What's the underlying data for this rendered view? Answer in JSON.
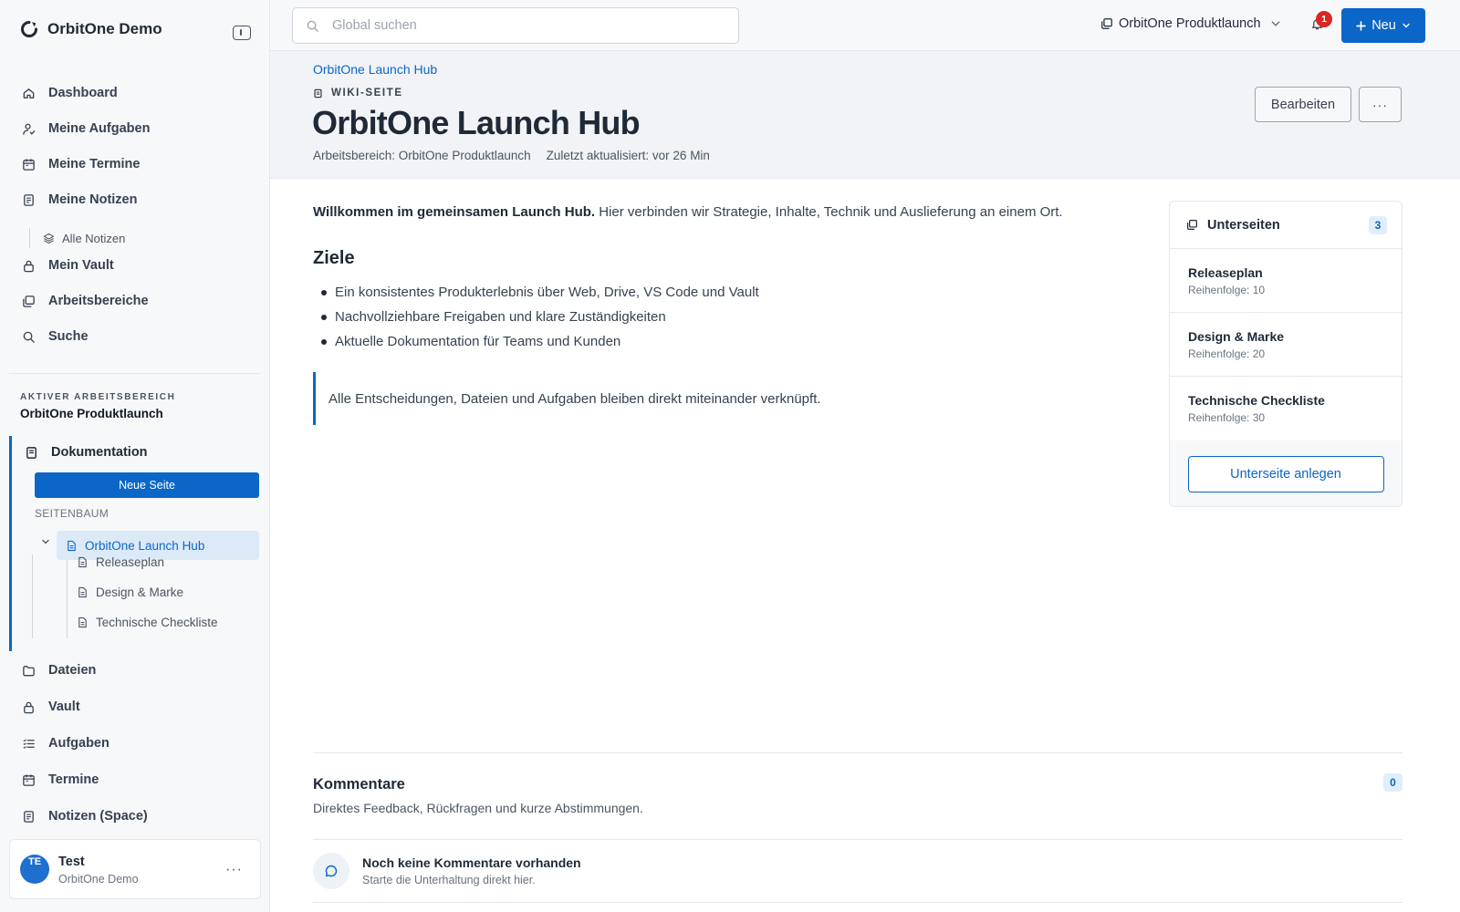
{
  "app": {
    "brand": "OrbitOne Demo"
  },
  "sidebar": {
    "nav": [
      {
        "label": "Dashboard",
        "icon": "home-icon"
      },
      {
        "label": "Meine Aufgaben",
        "icon": "user-check-icon"
      },
      {
        "label": "Meine Termine",
        "icon": "calendar-icon"
      },
      {
        "label": "Meine Notizen",
        "icon": "note-icon"
      },
      {
        "label": "Mein Vault",
        "icon": "lock-icon"
      },
      {
        "label": "Arbeitsbereiche",
        "icon": "workspaces-icon"
      },
      {
        "label": "Suche",
        "icon": "search-icon"
      }
    ],
    "sub_nav": {
      "label": "Alle Notizen",
      "icon": "layers-icon"
    },
    "active_workspace": {
      "label": "AKTIVER ARBEITSBEREICH",
      "name": "OrbitOne Produktlaunch"
    },
    "documentation": {
      "title": "Dokumentation",
      "new_page": "Neue Seite",
      "tree_label": "SEITENBAUM",
      "active_page": "OrbitOne Launch Hub",
      "children": [
        "Releaseplan",
        "Design & Marke",
        "Technische Checkliste"
      ]
    },
    "space_nav": [
      {
        "label": "Dateien",
        "icon": "folder-icon"
      },
      {
        "label": "Vault",
        "icon": "lock-icon"
      },
      {
        "label": "Aufgaben",
        "icon": "list-check-icon"
      },
      {
        "label": "Termine",
        "icon": "calendar-icon"
      },
      {
        "label": "Notizen (Space)",
        "icon": "note-icon"
      }
    ],
    "user": {
      "initials": "TE",
      "name": "Test",
      "org": "OrbitOne Demo",
      "more": "···"
    }
  },
  "topbar": {
    "search_placeholder": "Global suchen",
    "workspace": "OrbitOne Produktlaunch",
    "notifications": "1",
    "new_label": "Neu"
  },
  "page": {
    "breadcrumb": "OrbitOne Launch Hub",
    "kind": "WIKI-SEITE",
    "title": "OrbitOne Launch Hub",
    "workspace_meta": "Arbeitsbereich: OrbitOne Produktlaunch",
    "updated_meta": "Zuletzt aktualisiert: vor 26 Min",
    "edit": "Bearbeiten",
    "more": "···"
  },
  "content": {
    "intro_bold": "Willkommen im gemeinsamen Launch Hub.",
    "intro_rest": " Hier verbinden wir Strategie, Inhalte, Technik und Auslieferung an einem Ort.",
    "heading": "Ziele",
    "goals": [
      "Ein konsistentes Produkterlebnis über Web, Drive, VS Code und Vault",
      "Nachvollziehbare Freigaben und klare Zuständigkeiten",
      "Aktuelle Dokumentation für Teams und Kunden"
    ],
    "quote": "Alle Entscheidungen, Dateien und Aufgaben bleiben direkt miteinander verknüpft."
  },
  "subpages": {
    "title": "Unterseiten",
    "count": "3",
    "items": [
      {
        "title": "Releaseplan",
        "order": "Reihenfolge: 10"
      },
      {
        "title": "Design & Marke",
        "order": "Reihenfolge: 20"
      },
      {
        "title": "Technische Checkliste",
        "order": "Reihenfolge: 30"
      }
    ],
    "add": "Unterseite anlegen"
  },
  "comments": {
    "title": "Kommentare",
    "desc": "Direktes Feedback, Rückfragen und kurze Abstimmungen.",
    "count": "0",
    "empty": "Noch keine Kommentare vorhanden",
    "hint": "Starte die Unterhaltung direkt hier."
  },
  "colors": {
    "accent": "#0b66c8",
    "badge": "#dc2626"
  }
}
